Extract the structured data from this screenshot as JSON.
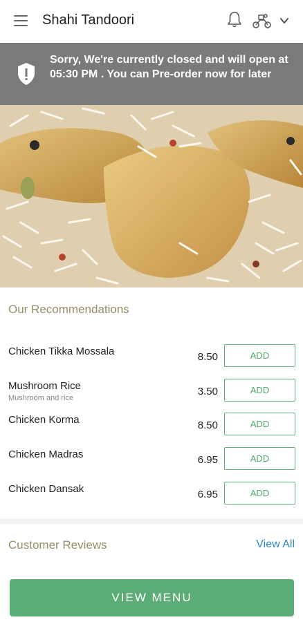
{
  "header": {
    "title": "Shahi Tandoori",
    "icons": [
      "menu-icon",
      "bell-icon",
      "delivery-rider-icon",
      "chevron-down-icon"
    ]
  },
  "banner": {
    "message": "Sorry, We're currently closed and will open at 05:30 PM . You can Pre-order now for later",
    "icon": "shield-alert-icon"
  },
  "hero": {
    "alt": "chicken-biryani-image"
  },
  "recommendations": {
    "title": "Our Recommendations",
    "items": [
      {
        "name": "Chicken Tikka Mossala",
        "description": "",
        "price": "8.50",
        "action": "ADD"
      },
      {
        "name": "Mushroom Rice",
        "description": "Mushroom and rice",
        "price": "3.50",
        "action": "ADD"
      },
      {
        "name": "Chicken Korma",
        "description": "",
        "price": "8.50",
        "action": "ADD"
      },
      {
        "name": "Chicken Madras",
        "description": "",
        "price": "6.95",
        "action": "ADD"
      },
      {
        "name": "Chicken Dansak",
        "description": "",
        "price": "6.95",
        "action": "ADD"
      }
    ]
  },
  "reviews": {
    "title": "Customer Reviews",
    "view_all": "View All"
  },
  "footer": {
    "view_menu": "VIEW MENU"
  },
  "colors": {
    "banner_bg": "#7a7a7a",
    "accent_green": "#5cae76",
    "section_title": "#9a8d6a",
    "link_blue": "#2f86c9"
  }
}
